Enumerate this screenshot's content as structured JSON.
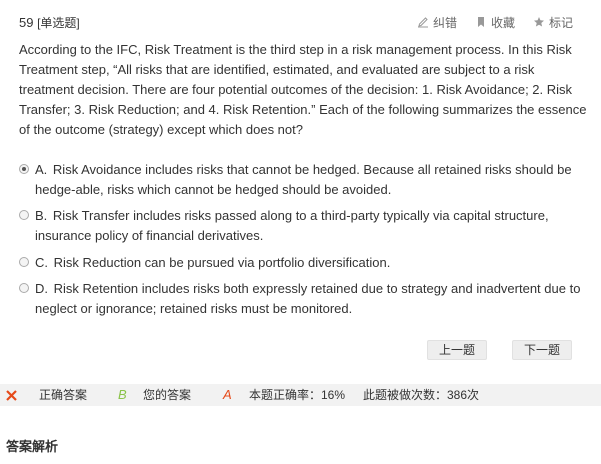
{
  "question": {
    "number": "59",
    "type": "[单选题]",
    "stem": "According to the IFC, Risk Treatment is the third step in a risk management process. In this Risk Treatment step, “All risks that are identified, estimated, and evaluated are subject to a risk treatment decision. There are four potential outcomes of the decision: 1. Risk Avoidance; 2. Risk Transfer; 3. Risk Reduction; and 4. Risk Retention.” Each of the following summarizes the essence of the outcome (strategy) except which does not?"
  },
  "tools": {
    "correct_label": "纠错",
    "favorite_label": "收藏",
    "mark_label": "标记"
  },
  "options": [
    {
      "letter": "A.",
      "text": "Risk Avoidance includes risks that cannot be hedged. Because all retained risks should be hedge-able, risks which cannot be hedged should be avoided.",
      "selected": true
    },
    {
      "letter": "B.",
      "text": "Risk Transfer includes risks passed along to a third-party typically via capital structure, insurance policy of financial derivatives.",
      "selected": false
    },
    {
      "letter": "C.",
      "text": "Risk Reduction can be pursued via portfolio diversification.",
      "selected": false
    },
    {
      "letter": "D.",
      "text": "Risk Retention includes risks both expressly retained due to strategy and inadvertent due to neglect or ignorance; retained risks must be monitored.",
      "selected": false
    }
  ],
  "navigation": {
    "prev_label": "上一题",
    "next_label": "下一题"
  },
  "answer_bar": {
    "correct_answer_label": "正确答案",
    "correct_answer_value": "B",
    "your_answer_label": "您的答案",
    "your_answer_value": "A",
    "accuracy_text": "本题正确率：16%",
    "attempts_text": "此题被做次数：386次",
    "status_color": "#e64a19"
  },
  "analysis": {
    "title": "答案解析"
  }
}
